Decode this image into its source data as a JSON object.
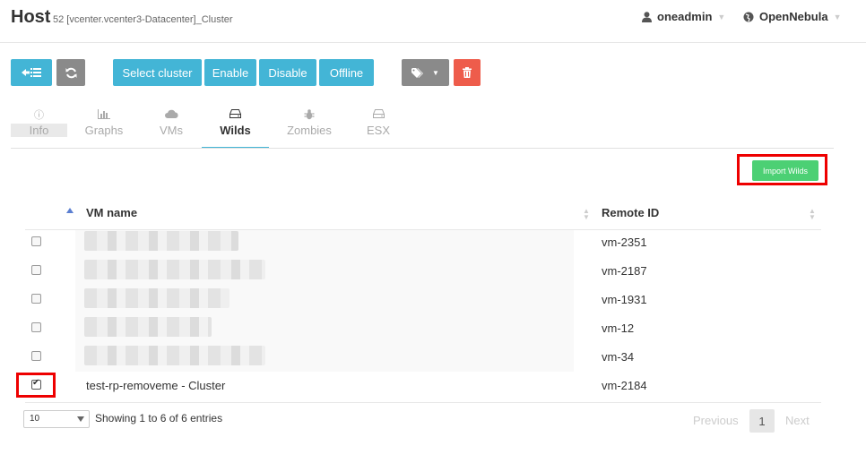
{
  "header": {
    "title": "Host",
    "subtitle": "52 [vcenter.vcenter3-Datacenter]_Cluster",
    "user": "oneadmin",
    "zone": "OpenNebula"
  },
  "toolbar": {
    "back_icon": "back-list-icon",
    "refresh_icon": "refresh-icon",
    "select_cluster_label": "Select cluster",
    "enable_label": "Enable",
    "disable_label": "Disable",
    "offline_label": "Offline",
    "tags_icon": "tags-icon",
    "delete_icon": "trash-icon",
    "colors": {
      "primary": "#43b5d6",
      "secondary": "#8a8a8a",
      "alert": "#ee5c4b"
    }
  },
  "tabs": [
    {
      "label": "Info",
      "icon": "info-icon"
    },
    {
      "label": "Graphs",
      "icon": "bar-chart-icon"
    },
    {
      "label": "VMs",
      "icon": "cloud-icon"
    },
    {
      "label": "Wilds",
      "icon": "hdd-icon",
      "active": true
    },
    {
      "label": "Zombies",
      "icon": "bug-icon"
    },
    {
      "label": "ESX",
      "icon": "hdd-icon"
    }
  ],
  "import_wilds_label": "Import Wilds",
  "table": {
    "columns": [
      "VM name",
      "Remote ID"
    ],
    "rows": [
      {
        "name": "",
        "remote_id": "vm-2351",
        "checked": false
      },
      {
        "name": "",
        "remote_id": "vm-2187",
        "checked": false
      },
      {
        "name": "",
        "remote_id": "vm-1931",
        "checked": false
      },
      {
        "name": "",
        "remote_id": "vm-12",
        "checked": false
      },
      {
        "name": "",
        "remote_id": "vm-34",
        "checked": false
      },
      {
        "name": "test-rp-removeme - Cluster",
        "remote_id": "vm-2184",
        "checked": true
      }
    ]
  },
  "footer": {
    "page_size": "10",
    "info": "Showing 1 to 6 of 6 entries",
    "previous": "Previous",
    "current_page": "1",
    "next": "Next"
  }
}
